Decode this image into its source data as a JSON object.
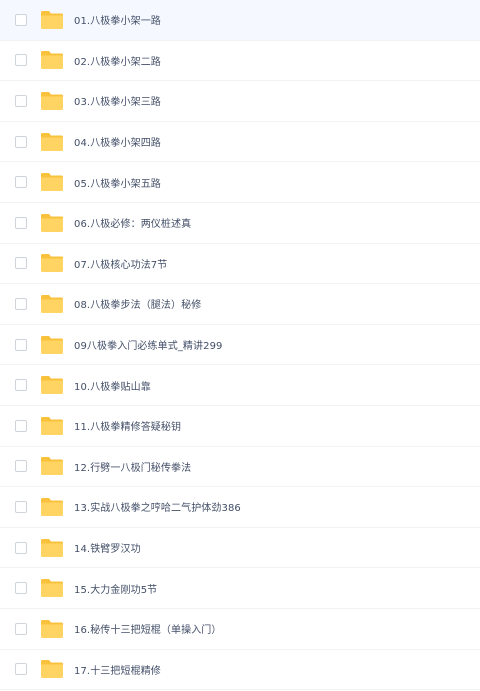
{
  "icons": {
    "checkbox": "checkbox",
    "folder": "folder-icon"
  },
  "colors": {
    "folder_body": "#ffd463",
    "folder_tab": "#f9c23c",
    "text": "#424e67",
    "divider": "#f1f2f4"
  },
  "files": [
    {
      "name": "01.八极拳小架一路"
    },
    {
      "name": "02.八极拳小架二路"
    },
    {
      "name": "03.八极拳小架三路"
    },
    {
      "name": "04.八极拳小架四路"
    },
    {
      "name": "05.八极拳小架五路"
    },
    {
      "name": "06.八极必修：两仪桩述真"
    },
    {
      "name": "07.八极核心功法7节"
    },
    {
      "name": "08.八极拳步法（腿法）秘修"
    },
    {
      "name": "09八极拳入门必练单式_精讲299"
    },
    {
      "name": "10.八极拳贴山靠"
    },
    {
      "name": "11.八极拳精修答疑秘钥"
    },
    {
      "name": "12.行劈一八极门秘传拳法"
    },
    {
      "name": "13.实战八极拳之哼哈二气护体劲386"
    },
    {
      "name": "14.铁臂罗汉功"
    },
    {
      "name": "15.大力金刚功5节"
    },
    {
      "name": "16.秘传十三把短棍（单操入门）"
    },
    {
      "name": "17.十三把短棍精修"
    }
  ]
}
